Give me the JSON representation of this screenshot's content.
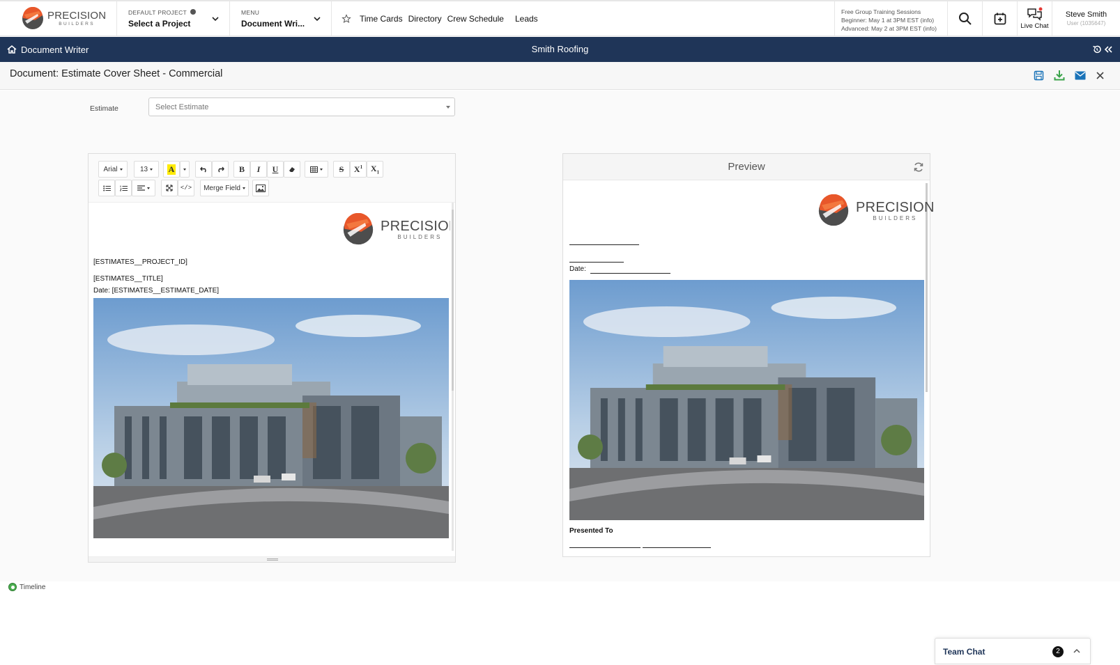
{
  "header": {
    "logo": {
      "name": "PRECISION",
      "sub": "BUILDERS"
    },
    "project": {
      "label": "DEFAULT PROJECT",
      "value": "Select a Project"
    },
    "menu": {
      "label": "MENU",
      "value": "Document Wri..."
    },
    "quick_links": [
      "Time Cards",
      "Directory",
      "Crew Schedule",
      "Leads"
    ],
    "training": {
      "title": "Free Group Training Sessions",
      "beginner": "Beginner:  May 1 at 3PM EST (info)",
      "advanced": "Advanced: May 2 at 3PM EST (info)"
    },
    "live_chat_label": "Live Chat",
    "user": {
      "name": "Steve Smith",
      "sub": "User (1035647)"
    }
  },
  "navbar": {
    "module": "Document Writer",
    "company": "Smith Roofing"
  },
  "document": {
    "title": "Document: Estimate Cover Sheet - Commercial"
  },
  "estimate": {
    "label": "Estimate",
    "placeholder": "Select Estimate"
  },
  "editor": {
    "toolbar": {
      "font": "Arial",
      "size": "13",
      "merge_field": "Merge Field"
    },
    "merge_fields": [
      "[ESTIMATES__PROJECT_ID]",
      "[ESTIMATES__TITLE]",
      "Date:  [ESTIMATES__ESTIMATE_DATE]"
    ]
  },
  "preview": {
    "title": "Preview",
    "date_label": "Date:",
    "presented_to": "Presented To"
  },
  "timeline_label": "Timeline",
  "team_chat": {
    "label": "Team Chat",
    "count": "2"
  },
  "colors": {
    "navy": "#1f3558",
    "accent_orange": "#e8572a",
    "action_blue": "#1a73b8",
    "download_green": "#3aa34a"
  }
}
